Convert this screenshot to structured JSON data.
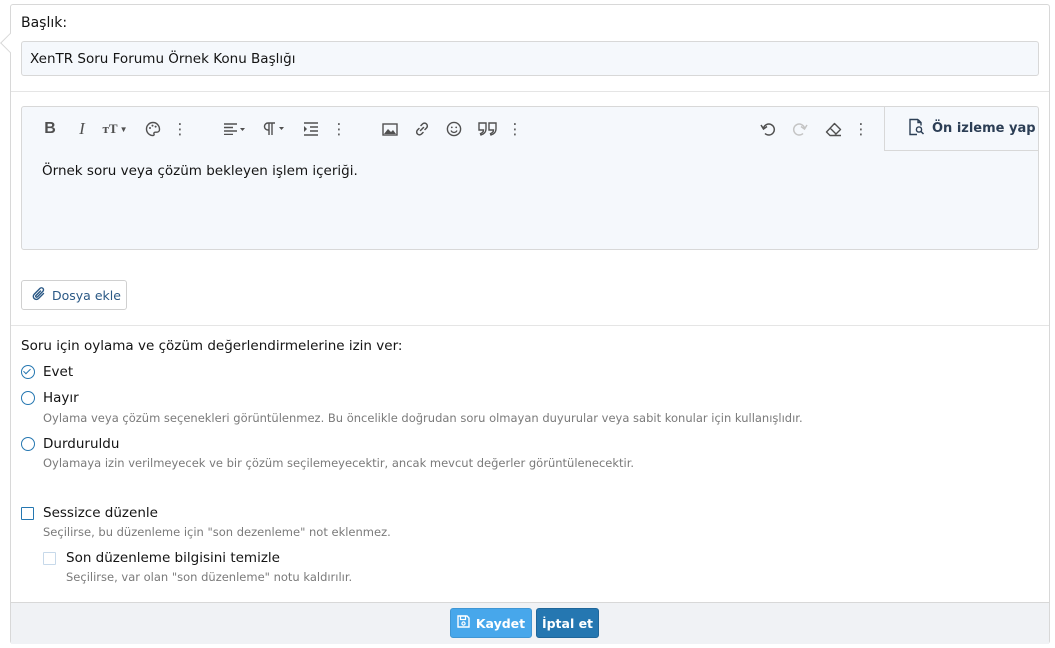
{
  "title_field": {
    "label": "Başlık:",
    "value": "XenTR Soru Forumu Örnek Konu Başlığı"
  },
  "editor": {
    "toolbar": {
      "bold": "B",
      "italic": "I",
      "font_size": "тТ",
      "more": "⋮",
      "icons": [
        "bold-icon",
        "italic-icon",
        "font-size-icon",
        "palette-icon",
        "more-icon",
        "align-icon",
        "paragraph-icon",
        "indent-icon",
        "more-icon",
        "image-icon",
        "link-icon",
        "smiley-icon",
        "quote-icon",
        "more-icon",
        "undo-icon",
        "redo-icon",
        "eraser-icon",
        "more-icon"
      ]
    },
    "preview_label": "Ön izleme yap",
    "content": "Örnek soru veya çözüm bekleyen işlem içeriği."
  },
  "attach_label": "Dosya ekle",
  "voting": {
    "heading": "Soru için oylama ve çözüm değerlendirmelerine izin ver:",
    "options": [
      {
        "label": "Evet",
        "hint": "",
        "checked": true
      },
      {
        "label": "Hayır",
        "hint": "Oylama veya çözüm seçenekleri görüntülenmez. Bu öncelikle doğrudan soru olmayan duyurular veya sabit konular için kullanışlıdır.",
        "checked": false
      },
      {
        "label": "Durduruldu",
        "hint": "Oylamaya izin verilmeyecek ve bir çözüm seçilemeyecektir, ancak mevcut değerler görüntülenecektir.",
        "checked": false
      }
    ]
  },
  "silent_edit": {
    "label": "Sessizce düzenle",
    "hint": "Seçilirse, bu düzenleme için \"son dezenleme\" not eklenmez.",
    "sub": {
      "label": "Son düzenleme bilgisini temizle",
      "hint": "Seçilirse, var olan \"son düzenleme\" notu kaldırılır."
    }
  },
  "buttons": {
    "save": "Kaydet",
    "cancel": "İptal et"
  },
  "colors": {
    "accent": "#2577b1",
    "save_button": "#47a7eb",
    "input_background": "#f5f8fc"
  }
}
